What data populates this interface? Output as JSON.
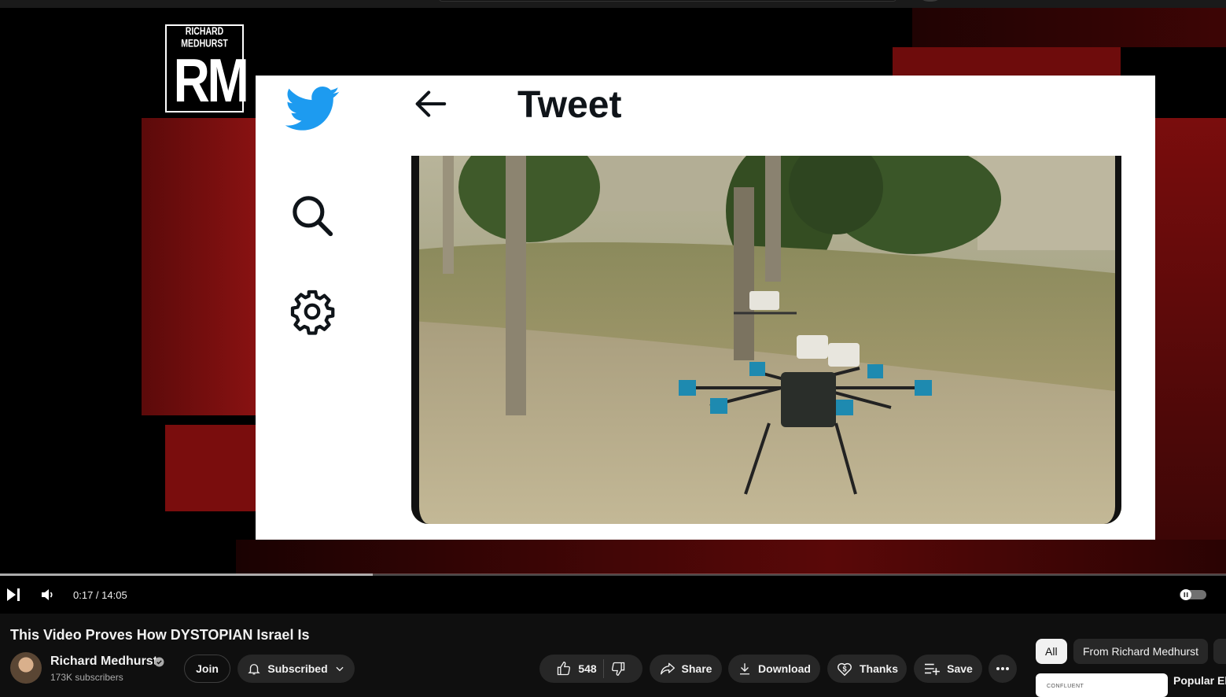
{
  "player": {
    "logo": {
      "top_text": "RICHARD MEDHURST",
      "initials": "RM"
    },
    "tweet": {
      "header_title": "Tweet"
    },
    "controls": {
      "time": "0:17 / 14:05",
      "progress_fraction": 0.304
    },
    "colors": {
      "twitter_blue": "#1d9bf0",
      "bg_red": "#7a0d0d"
    }
  },
  "video": {
    "title": "This Video Proves How DYSTOPIAN Israel Is",
    "channel": {
      "name": "Richard Medhurst",
      "subscribers": "173K subscribers"
    },
    "buttons": {
      "join": "Join",
      "subscribed": "Subscribed",
      "likes": "548",
      "share": "Share",
      "download": "Download",
      "thanks": "Thanks",
      "save": "Save"
    }
  },
  "sidebar": {
    "chips": [
      "All",
      "From Richard Medhurst"
    ],
    "reco": {
      "thumb_text": "CONFLUENT",
      "title": "Popular Eb"
    }
  }
}
